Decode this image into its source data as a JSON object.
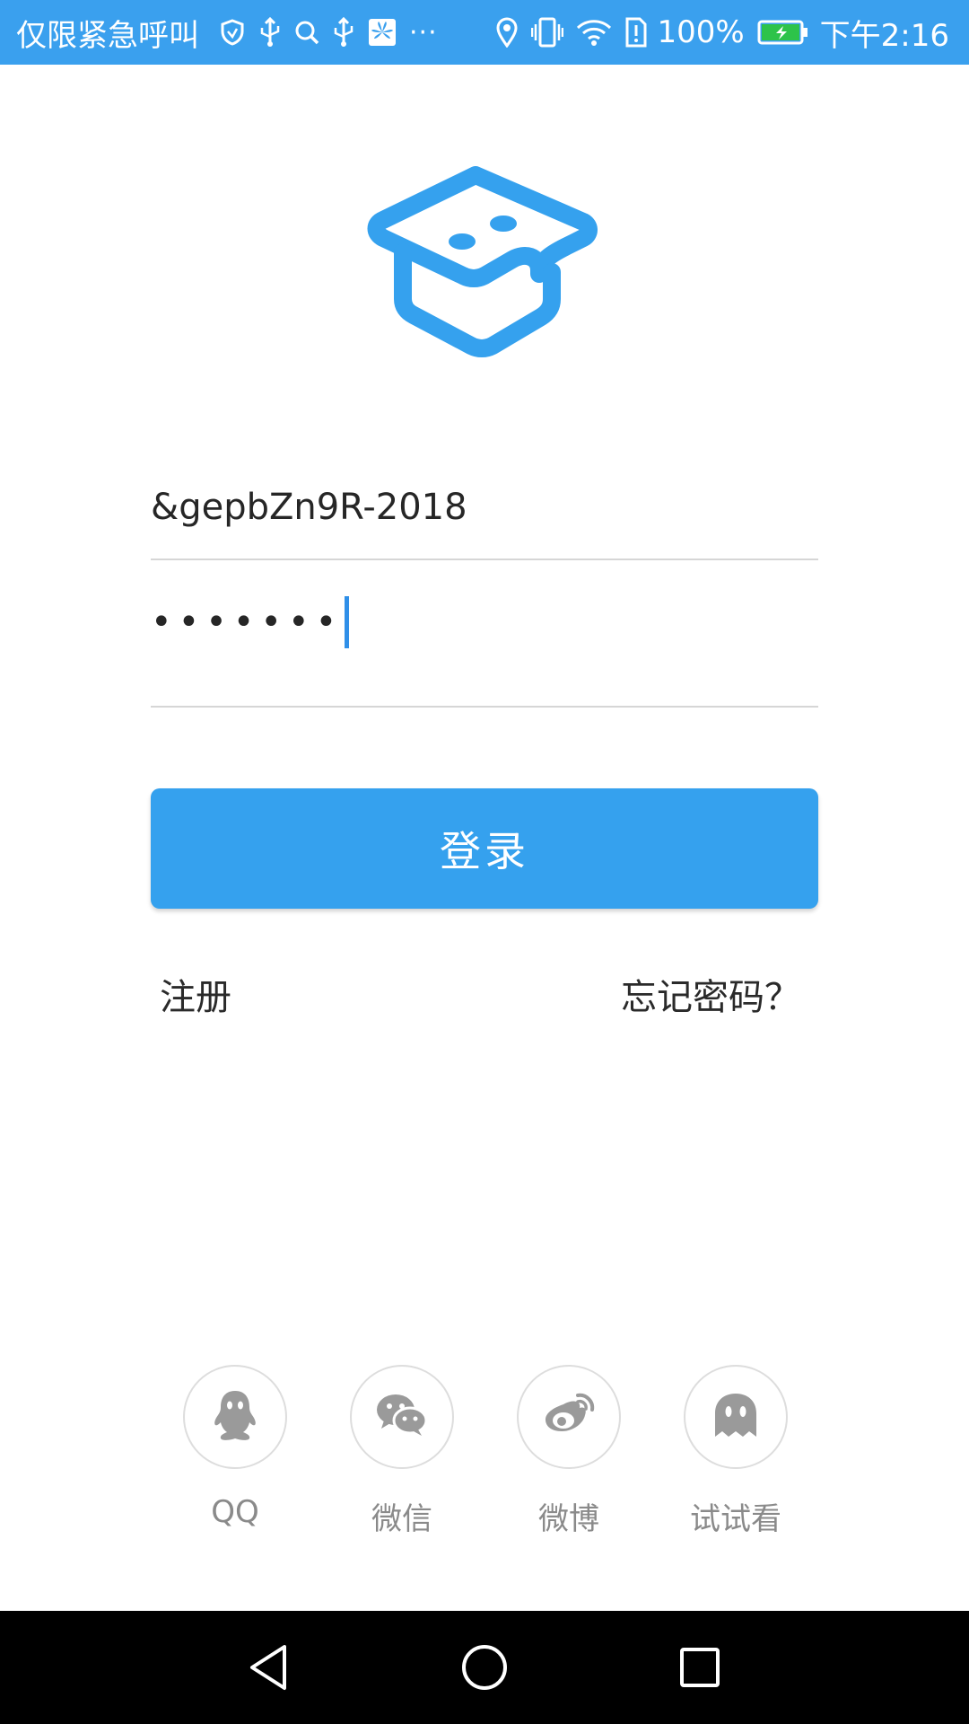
{
  "status_bar": {
    "carrier_text": "仅限紧急呼叫",
    "overflow": "···",
    "battery_percent": "100%",
    "time": "下午2:16",
    "left_icons": [
      "vpn-shield-icon",
      "usb-icon",
      "search-icon",
      "usb-icon",
      "huawei-icon"
    ],
    "right_icons": [
      "location-icon",
      "vibrate-icon",
      "wifi-icon",
      "sim-icon",
      "battery-charging-icon"
    ],
    "battery_level": 1.0
  },
  "login": {
    "username_value": "&gepbZn9R-2018",
    "password_mask": "•••••••",
    "login_label": "登录",
    "register_label": "注册",
    "forgot_label": "忘记密码？"
  },
  "social": [
    {
      "label": "QQ",
      "icon": "qq-penguin-icon"
    },
    {
      "label": "微信",
      "icon": "wechat-icon"
    },
    {
      "label": "微博",
      "icon": "weibo-icon"
    },
    {
      "label": "试试看",
      "icon": "ghost-icon"
    }
  ],
  "colors": {
    "accent": "#35a1ee",
    "status_bar": "#3aa0ee",
    "icon_gray": "#9a9a9a",
    "text_dark": "#262626"
  },
  "nav_bar": {
    "buttons": [
      "back-icon",
      "home-icon",
      "recents-icon"
    ]
  }
}
